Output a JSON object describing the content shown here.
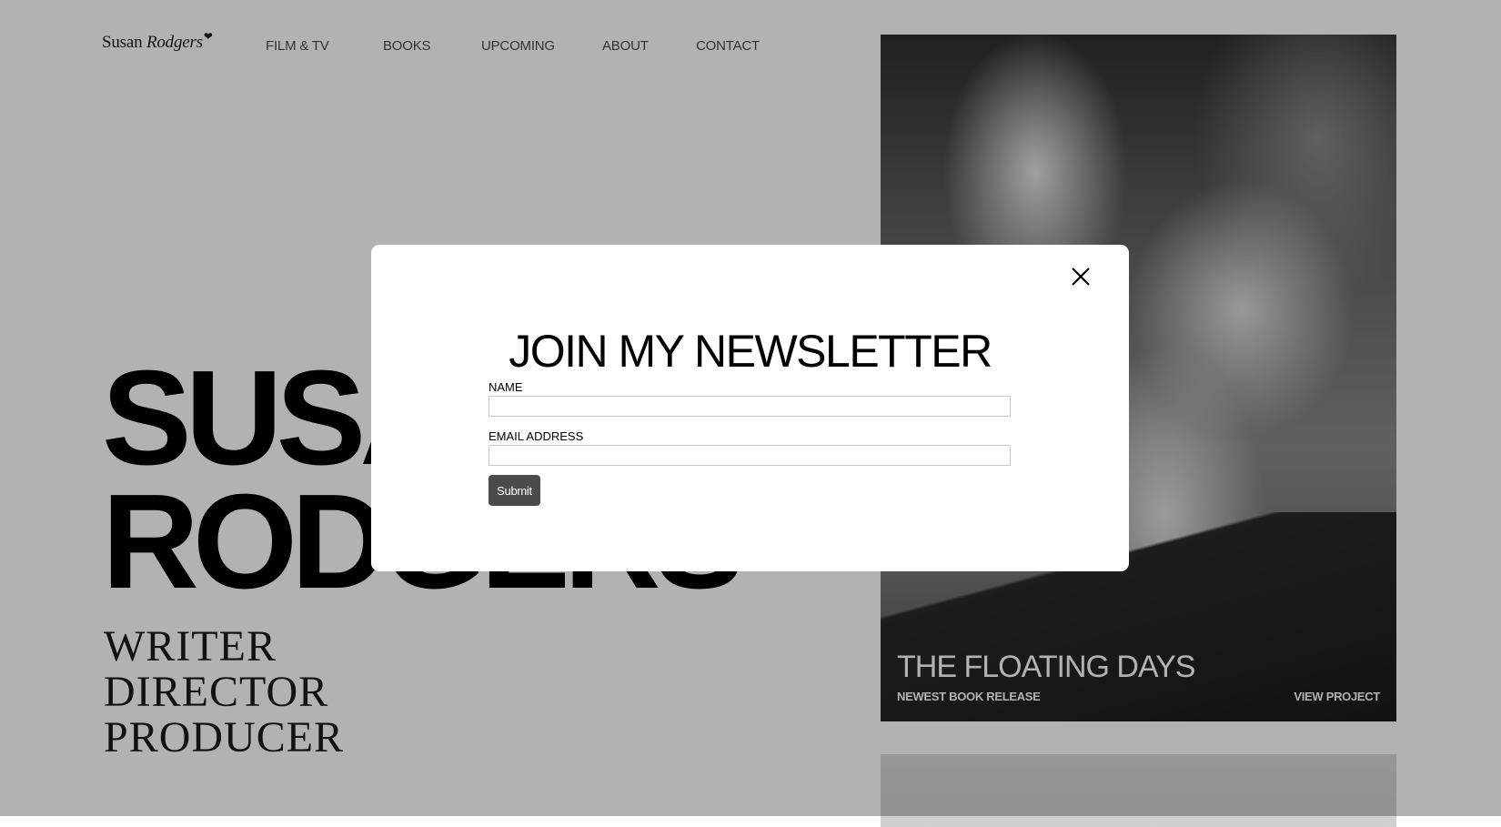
{
  "site": {
    "logo_first": "Susan",
    "logo_second": "Rodgers",
    "nav": [
      {
        "label": "FILM & TV"
      },
      {
        "label": "BOOKS"
      },
      {
        "label": "UPCOMING"
      },
      {
        "label": "ABOUT"
      },
      {
        "label": "CONTACT"
      }
    ]
  },
  "hero": {
    "name_line1": "SUSAN",
    "name_line2": "RODGERS",
    "roles": [
      "WRITER",
      "DIRECTOR",
      "PRODUCER"
    ]
  },
  "featured": {
    "title": "THE FLOATING DAYS",
    "subtitle": "NEWEST BOOK RELEASE",
    "link": "VIEW PROJECT"
  },
  "modal": {
    "title": "JOIN MY NEWSLETTER",
    "name_label": "NAME",
    "name_value": "",
    "email_label": "EMAIL ADDRESS",
    "email_value": "",
    "submit_label": "Submit",
    "close_icon": "close-icon"
  },
  "colors": {
    "overlay": "#000000",
    "submit_bg": "#4b4b4b",
    "modal_bg": "#ffffff"
  }
}
